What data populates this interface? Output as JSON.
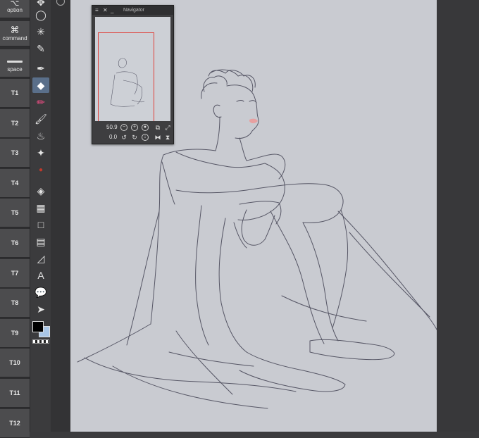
{
  "modifier_keys": [
    {
      "id": "option",
      "glyph": "⌥",
      "label": "option"
    },
    {
      "id": "command",
      "glyph": "⌘",
      "label": "command"
    },
    {
      "id": "space",
      "glyph": "▬",
      "label": "space"
    }
  ],
  "shortcut_keys": [
    "T1",
    "T2",
    "T3",
    "T4",
    "T5",
    "T6",
    "T7",
    "T8",
    "T9",
    "T10",
    "T11",
    "T12"
  ],
  "tools": [
    {
      "name": "move-icon",
      "glyph": "✥"
    },
    {
      "name": "lasso-icon",
      "glyph": "◯"
    },
    {
      "name": "magic-wand-icon",
      "glyph": "✳"
    },
    {
      "name": "eyedropper-icon",
      "glyph": "✎"
    },
    {
      "name": "pen-icon",
      "glyph": "✒"
    },
    {
      "name": "eraser-icon",
      "glyph": "◆"
    },
    {
      "name": "pencil-icon",
      "glyph": "✏"
    },
    {
      "name": "brush-icon",
      "glyph": "🖌"
    },
    {
      "name": "airbrush-icon",
      "glyph": "♨"
    },
    {
      "name": "decoration-icon",
      "glyph": "✦"
    },
    {
      "name": "blend-icon",
      "glyph": "●"
    },
    {
      "name": "fill-icon",
      "glyph": "◈"
    },
    {
      "name": "gradient-icon",
      "glyph": "▦"
    },
    {
      "name": "figure-icon",
      "glyph": "□"
    },
    {
      "name": "frame-icon",
      "glyph": "▤"
    },
    {
      "name": "ruler-icon",
      "glyph": "◿"
    },
    {
      "name": "text-icon",
      "glyph": "A"
    },
    {
      "name": "balloon-icon",
      "glyph": "💬"
    },
    {
      "name": "operation-icon",
      "glyph": "➤"
    }
  ],
  "navigator": {
    "title": "Navigator",
    "zoom": "50.9",
    "rotation": "0.0"
  },
  "colors": {
    "main": "#000000",
    "sub": "#a9c6e6",
    "canvas": "#c9cbd1"
  }
}
